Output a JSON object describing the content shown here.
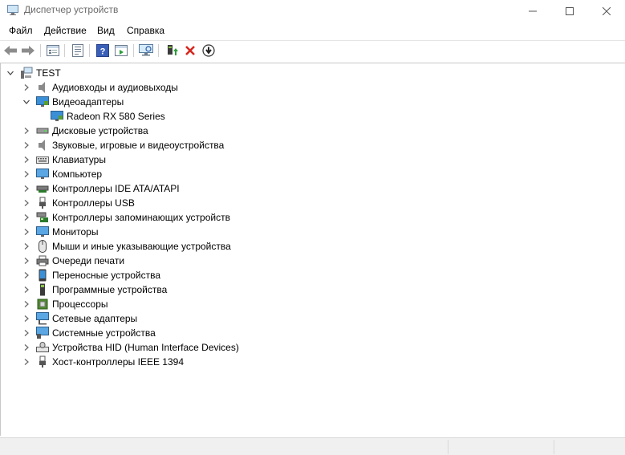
{
  "window": {
    "title": "Диспетчер устройств"
  },
  "menu": [
    "Файл",
    "Действие",
    "Вид",
    "Справка"
  ],
  "toolbar": [
    "back-icon",
    "forward-icon",
    "properties-icon",
    "show-hidden-icon",
    "help-icon",
    "action-pane-icon",
    "scan-hardware-icon",
    "update-driver-icon",
    "uninstall-icon",
    "disable-icon"
  ],
  "tree": {
    "root": "TEST",
    "items": [
      {
        "label": "Аудиовходы и аудиовыходы",
        "icon": "speaker-icon",
        "expanded": false
      },
      {
        "label": "Видеоадаптеры",
        "icon": "display-adapter-icon",
        "expanded": true,
        "children": [
          {
            "label": "Radeon RX 580 Series",
            "icon": "display-adapter-icon"
          }
        ]
      },
      {
        "label": "Дисковые устройства",
        "icon": "disk-icon",
        "expanded": false
      },
      {
        "label": "Звуковые, игровые и видеоустройства",
        "icon": "speaker-icon",
        "expanded": false
      },
      {
        "label": "Клавиатуры",
        "icon": "keyboard-icon",
        "expanded": false
      },
      {
        "label": "Компьютер",
        "icon": "computer-icon",
        "expanded": false
      },
      {
        "label": "Контроллеры IDE ATA/ATAPI",
        "icon": "ide-controller-icon",
        "expanded": false
      },
      {
        "label": "Контроллеры USB",
        "icon": "usb-icon",
        "expanded": false
      },
      {
        "label": "Контроллеры запоминающих устройств",
        "icon": "storage-controller-icon",
        "expanded": false
      },
      {
        "label": "Мониторы",
        "icon": "monitor-icon",
        "expanded": false
      },
      {
        "label": "Мыши и иные указывающие устройства",
        "icon": "mouse-icon",
        "expanded": false
      },
      {
        "label": "Очереди печати",
        "icon": "printer-icon",
        "expanded": false
      },
      {
        "label": "Переносные устройства",
        "icon": "portable-device-icon",
        "expanded": false
      },
      {
        "label": "Программные устройства",
        "icon": "software-device-icon",
        "expanded": false
      },
      {
        "label": "Процессоры",
        "icon": "processor-icon",
        "expanded": false
      },
      {
        "label": "Сетевые адаптеры",
        "icon": "network-adapter-icon",
        "expanded": false
      },
      {
        "label": "Системные устройства",
        "icon": "system-device-icon",
        "expanded": false
      },
      {
        "label": "Устройства HID (Human Interface Devices)",
        "icon": "hid-icon",
        "expanded": false
      },
      {
        "label": "Хост-контроллеры IEEE 1394",
        "icon": "ieee1394-icon",
        "expanded": false
      }
    ]
  }
}
